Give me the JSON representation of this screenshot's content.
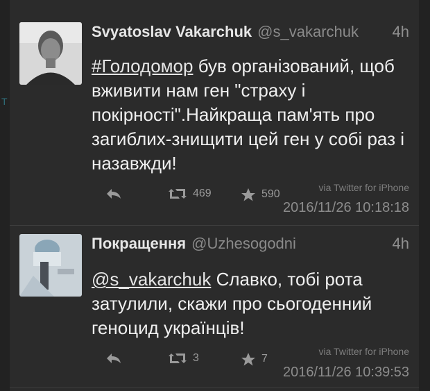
{
  "left_strip_letter": "T",
  "tweets": [
    {
      "name": "Svyatoslav Vakarchuk",
      "handle": "@s_vakarchuk",
      "time": "4h",
      "hashtag": "#Голодомор",
      "text_rest": " був організований, щоб вживити нам ген \"страху і покірності\".Найкраща пам'ять про загиблих-знищити цей ген у собі раз і назавжди!",
      "retweets": "469",
      "favorites": "590",
      "via": "via Twitter for iPhone",
      "stamp": "2016/11/26 10:18:18",
      "icons": [
        "reply-icon",
        "retweet-icon",
        "star-icon"
      ]
    },
    {
      "name": "Покращення",
      "handle": "@Uzhesogodni",
      "time": "4h",
      "mention": "@s_vakarchuk",
      "text_rest": " Славко, тобі рота затулили, скажи про сьогоденний геноцид українців!",
      "retweets": "3",
      "favorites": "7",
      "via": "via Twitter for iPhone",
      "stamp": "2016/11/26 10:39:53",
      "icons": [
        "reply-icon",
        "retweet-icon",
        "star-icon"
      ]
    }
  ],
  "colors": {
    "background": "#2b2b2b",
    "text": "#efefef",
    "muted": "#8f8f8f"
  }
}
